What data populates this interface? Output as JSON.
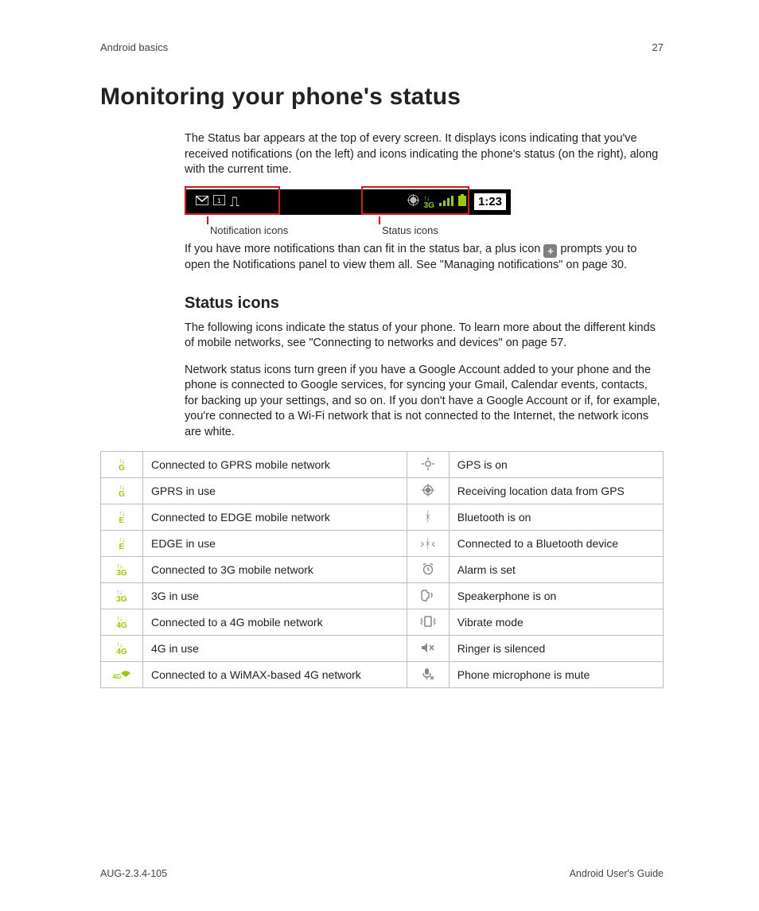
{
  "header": {
    "section": "Android basics",
    "page_number": "27"
  },
  "title": "Monitoring your phone's status",
  "intro": "The Status bar appears at the top of every screen. It displays icons indicating that you've received notifications (on the left) and icons indicating the phone's status (on the right), along with the current time.",
  "statusbar": {
    "time": "1:23",
    "callout_left": "Notification icons",
    "callout_right": "Status icons"
  },
  "after_bar_1": "If you have more notifications than can fit in the status bar, a plus icon",
  "after_bar_2": "prompts you to open the Notifications panel to view them all. See \"Managing notifications\" on page 30.",
  "subhead": "Status icons",
  "sub_p1": "The following icons indicate the status of your phone. To learn more about the different kinds of mobile networks, see \"Connecting to networks and devices\" on page 57.",
  "sub_p2": "Network status icons turn green if you have a Google Account added to your phone and the phone is connected to Google services, for syncing your Gmail, Calendar events, contacts, for backing up your settings, and so on. If you don't have a Google Account or if, for example, you're connected to a Wi-Fi network that is not connected to the Internet, the network icons are white.",
  "table": {
    "rows": [
      {
        "l_icon": "gprs",
        "l": "Connected to GPRS mobile network",
        "r_icon": "gps-outline",
        "r": "GPS is on"
      },
      {
        "l_icon": "gprs",
        "l": "GPRS in use",
        "r_icon": "gps-solid",
        "r": "Receiving location data from GPS"
      },
      {
        "l_icon": "edge",
        "l": "Connected to EDGE mobile network",
        "r_icon": "bluetooth",
        "r": "Bluetooth is on"
      },
      {
        "l_icon": "edge",
        "l": "EDGE in use",
        "r_icon": "bluetooth-conn",
        "r": "Connected to a Bluetooth device"
      },
      {
        "l_icon": "3g",
        "l": "Connected to 3G mobile network",
        "r_icon": "alarm",
        "r": "Alarm is set"
      },
      {
        "l_icon": "3g",
        "l": "3G in use",
        "r_icon": "speaker",
        "r": "Speakerphone is on"
      },
      {
        "l_icon": "4g",
        "l": "Connected to a 4G mobile network",
        "r_icon": "vibrate",
        "r": "Vibrate mode"
      },
      {
        "l_icon": "4g",
        "l": "4G in use",
        "r_icon": "silent",
        "r": "Ringer is silenced"
      },
      {
        "l_icon": "wimax",
        "l": "Connected to a WiMAX-based 4G network",
        "r_icon": "mic-mute",
        "r": "Phone microphone is mute"
      }
    ],
    "net_labels": {
      "gprs": "G",
      "edge": "E",
      "3g": "3G",
      "4g": "4G",
      "wimax": "4G"
    }
  },
  "footer": {
    "left": "AUG-2.3.4-105",
    "right": "Android User's Guide"
  }
}
